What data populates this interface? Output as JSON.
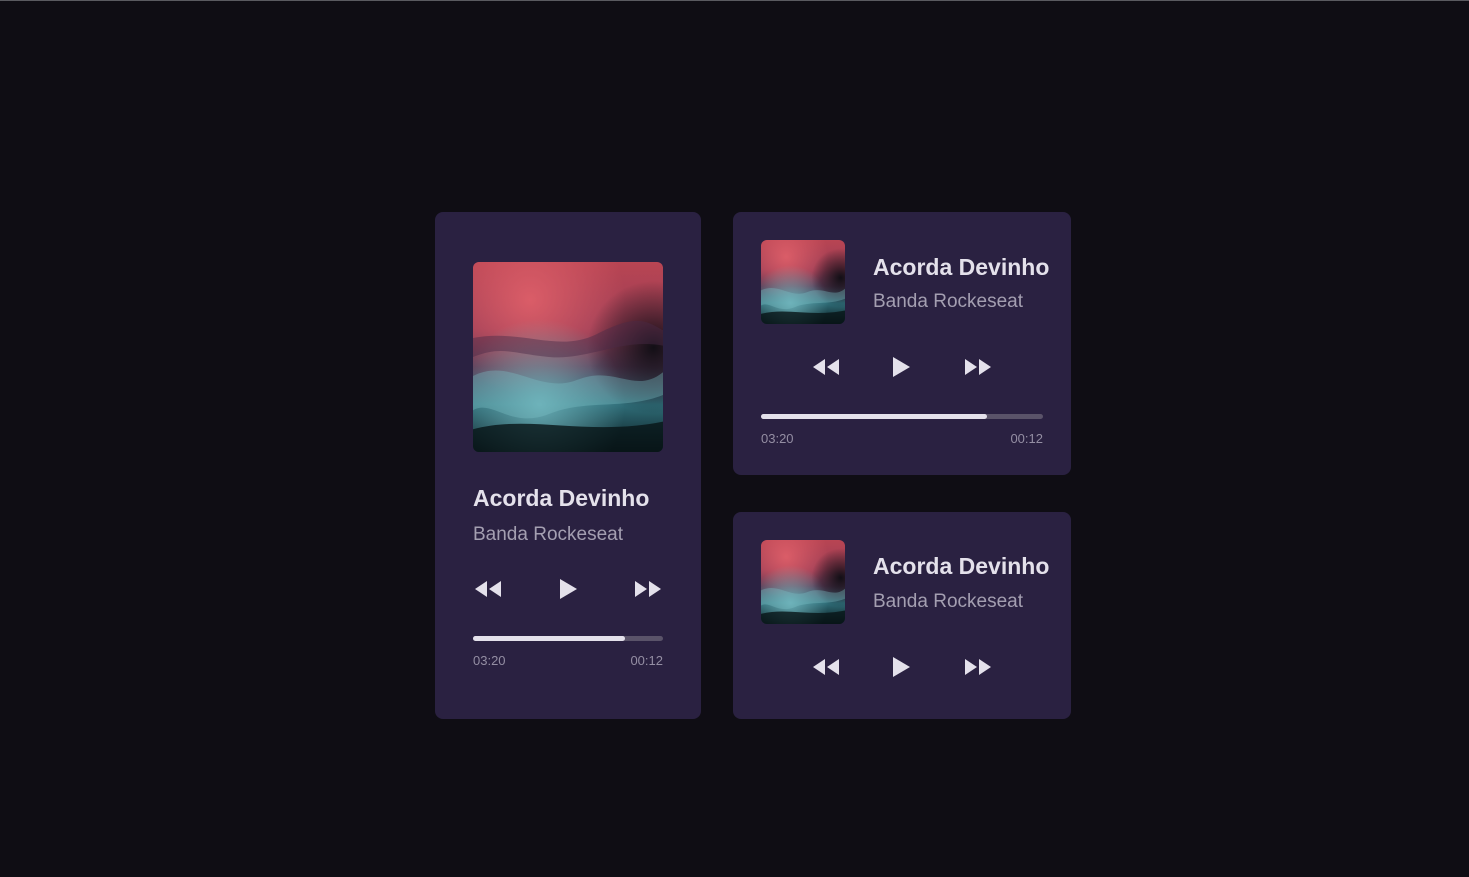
{
  "colors": {
    "page_background": "#0f0d14",
    "card_background": "#2a2141",
    "title_text": "#e4e1eb",
    "artist_text": "#a49fb1",
    "progress_track": "#5a5369",
    "progress_fill": "#e4e1eb"
  },
  "players": [
    {
      "variant": "vertical",
      "cover_icon": "album-cover-ink-art",
      "title": "Acorda Devinho",
      "artist": "Banda Rockeseat",
      "controls": {
        "prev_icon": "rewind-icon",
        "play_icon": "play-icon",
        "next_icon": "fast-forward-icon"
      },
      "progress": 0.8,
      "time_left": "03:20",
      "time_right": "00:12"
    },
    {
      "variant": "horizontal",
      "cover_icon": "album-cover-ink-art",
      "title": "Acorda Devinho",
      "artist": "Banda Rockeseat",
      "controls": {
        "prev_icon": "rewind-icon",
        "play_icon": "play-icon",
        "next_icon": "fast-forward-icon"
      },
      "progress": 0.8,
      "time_left": "03:20",
      "time_right": "00:12"
    },
    {
      "variant": "compact",
      "cover_icon": "album-cover-ink-art",
      "title": "Acorda Devinho",
      "artist": "Banda Rockeseat",
      "controls": {
        "prev_icon": "rewind-icon",
        "play_icon": "play-icon",
        "next_icon": "fast-forward-icon"
      }
    }
  ]
}
